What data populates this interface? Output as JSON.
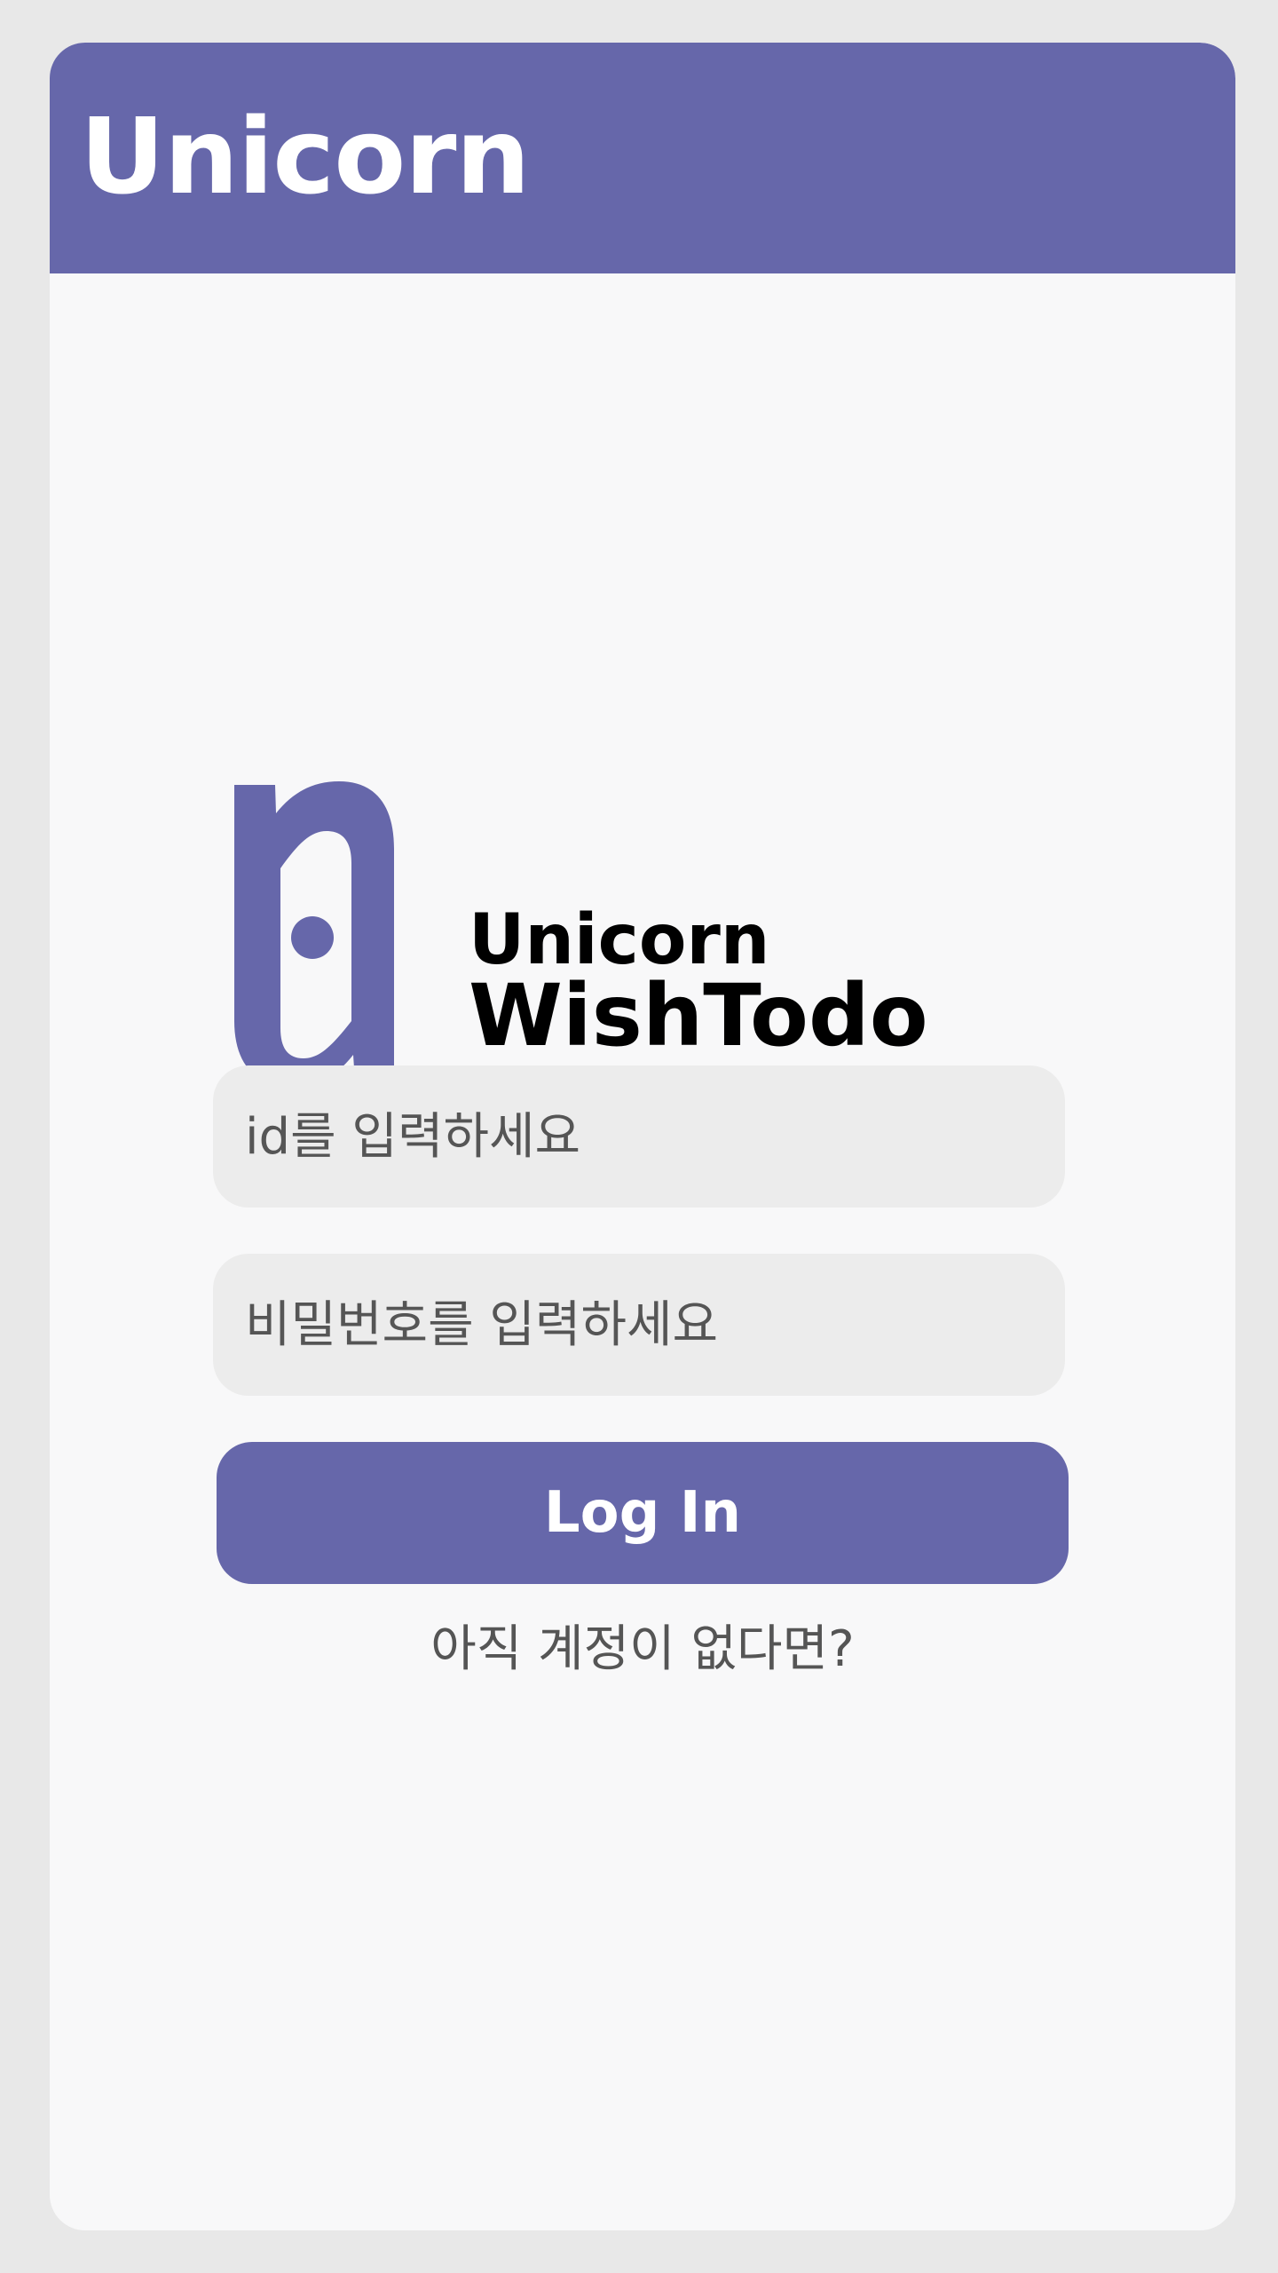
{
  "app": {
    "title": "Unicorn"
  },
  "logo": {
    "line1": "Unicorn",
    "line2": "WishTodo",
    "icon": "unicorn-logo-icon"
  },
  "login": {
    "id_placeholder": "id를 입력하세요",
    "id_value": "",
    "password_placeholder": "비밀번호를 입력하세요",
    "password_value": "",
    "button_label": "Log In",
    "signup_link": "아직 계정이 없다면?"
  },
  "colors": {
    "brand": "#6667aa",
    "background": "#f8f8f9",
    "input_background": "#ececec",
    "text_muted": "#555555"
  }
}
